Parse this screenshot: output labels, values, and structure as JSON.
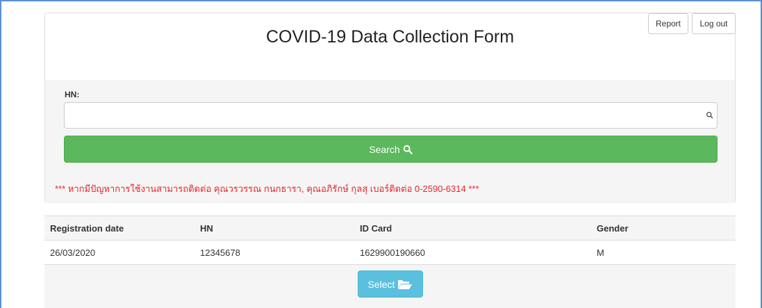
{
  "header": {
    "title": "COVID-19 Data Collection Form",
    "report_label": "Report",
    "logout_label": "Log out"
  },
  "search": {
    "hn_label": "HN:",
    "hn_value": "",
    "button_label": "Search",
    "icon": "search-icon"
  },
  "notice": "*** หากมีปัญหาการใช้งานสามารถติดต่อ คุณวรวรรณ กนกธารา, คุณอภิรักษ์ กุลสุ เบอร์ติดต่อ 0-2590-6314 ***",
  "results": {
    "columns": [
      "Registration date",
      "HN",
      "ID Card",
      "Gender"
    ],
    "rows": [
      [
        "26/03/2020",
        "12345678",
        "1629900190660",
        "M"
      ]
    ],
    "select_label": "Select",
    "select_icon": "folder-open-icon"
  },
  "colors": {
    "success": "#5cb85c",
    "info": "#5bc0de",
    "notice": "#e8262b",
    "frame": "#5b8fd6"
  }
}
